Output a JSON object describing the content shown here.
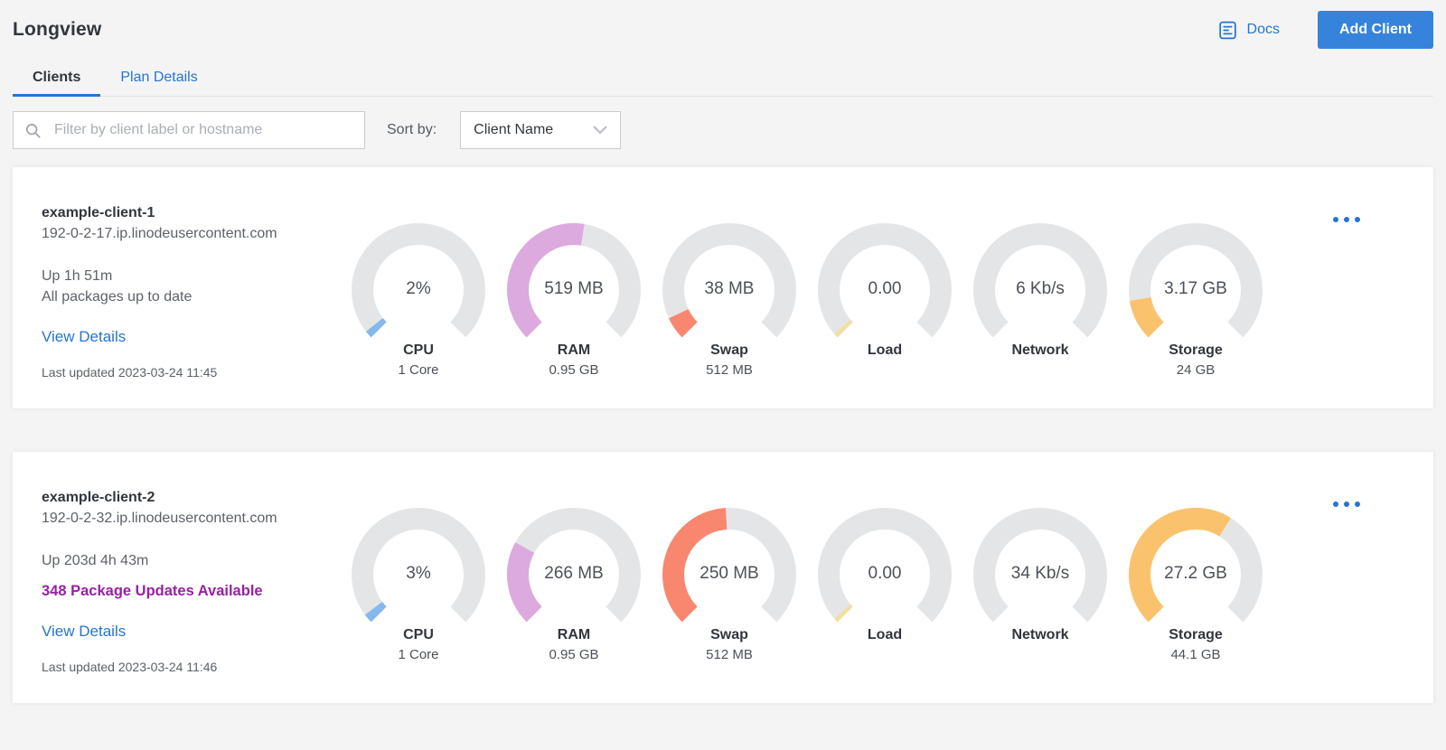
{
  "page": {
    "title": "Longview"
  },
  "header": {
    "docs_label": "Docs",
    "add_client_label": "Add Client"
  },
  "tabs": [
    {
      "label": "Clients",
      "active": true
    },
    {
      "label": "Plan Details",
      "active": false
    }
  ],
  "filter": {
    "placeholder": "Filter by client label or hostname",
    "sort_label": "Sort by:",
    "sort_value": "Client Name"
  },
  "colors": {
    "accent_blue": "#3683dc",
    "link_blue": "#2575d0",
    "alert_purple": "#991fa5",
    "gauge_track": "#e4e5e6",
    "page_bg": "#f4f4f5"
  },
  "clients": [
    {
      "name": "example-client-1",
      "hostname": "192-0-2-17.ip.linodeusercontent.com",
      "uptime": "Up 1h 51m",
      "packages": "All packages up to date",
      "packages_alert": false,
      "view_details_label": "View Details",
      "last_updated": "Last updated 2023-03-24 11:45",
      "gauges": [
        {
          "title": "CPU",
          "value": "2%",
          "sub": "1 Core",
          "fraction": 0.025,
          "color": "#85b8ed"
        },
        {
          "title": "RAM",
          "value": "519 MB",
          "sub": "0.95 GB",
          "fraction": 0.533,
          "color": "#dcaade"
        },
        {
          "title": "Swap",
          "value": "38 MB",
          "sub": "512 MB",
          "fraction": 0.074,
          "color": "#f9876f"
        },
        {
          "title": "Load",
          "value": "0.00",
          "sub": "",
          "fraction": 0.015,
          "color": "#f2dfa0"
        },
        {
          "title": "Network",
          "value": "6 Kb/s",
          "sub": "",
          "fraction": 0,
          "color": "#e4e5e6"
        },
        {
          "title": "Storage",
          "value": "3.17 GB",
          "sub": "24 GB",
          "fraction": 0.132,
          "color": "#fbc26e"
        }
      ]
    },
    {
      "name": "example-client-2",
      "hostname": "192-0-2-32.ip.linodeusercontent.com",
      "uptime": "Up 203d 4h 43m",
      "packages": "348 Package Updates Available",
      "packages_alert": true,
      "view_details_label": "View Details",
      "last_updated": "Last updated 2023-03-24 11:46",
      "gauges": [
        {
          "title": "CPU",
          "value": "3%",
          "sub": "1 Core",
          "fraction": 0.03,
          "color": "#85b8ed"
        },
        {
          "title": "RAM",
          "value": "266 MB",
          "sub": "0.95 GB",
          "fraction": 0.273,
          "color": "#dcaade"
        },
        {
          "title": "Swap",
          "value": "250 MB",
          "sub": "512 MB",
          "fraction": 0.488,
          "color": "#f9876f"
        },
        {
          "title": "Load",
          "value": "0.00",
          "sub": "",
          "fraction": 0.015,
          "color": "#f2dfa0"
        },
        {
          "title": "Network",
          "value": "34 Kb/s",
          "sub": "",
          "fraction": 0,
          "color": "#e4e5e6"
        },
        {
          "title": "Storage",
          "value": "27.2 GB",
          "sub": "44.1 GB",
          "fraction": 0.617,
          "color": "#fbc26e"
        }
      ]
    }
  ]
}
